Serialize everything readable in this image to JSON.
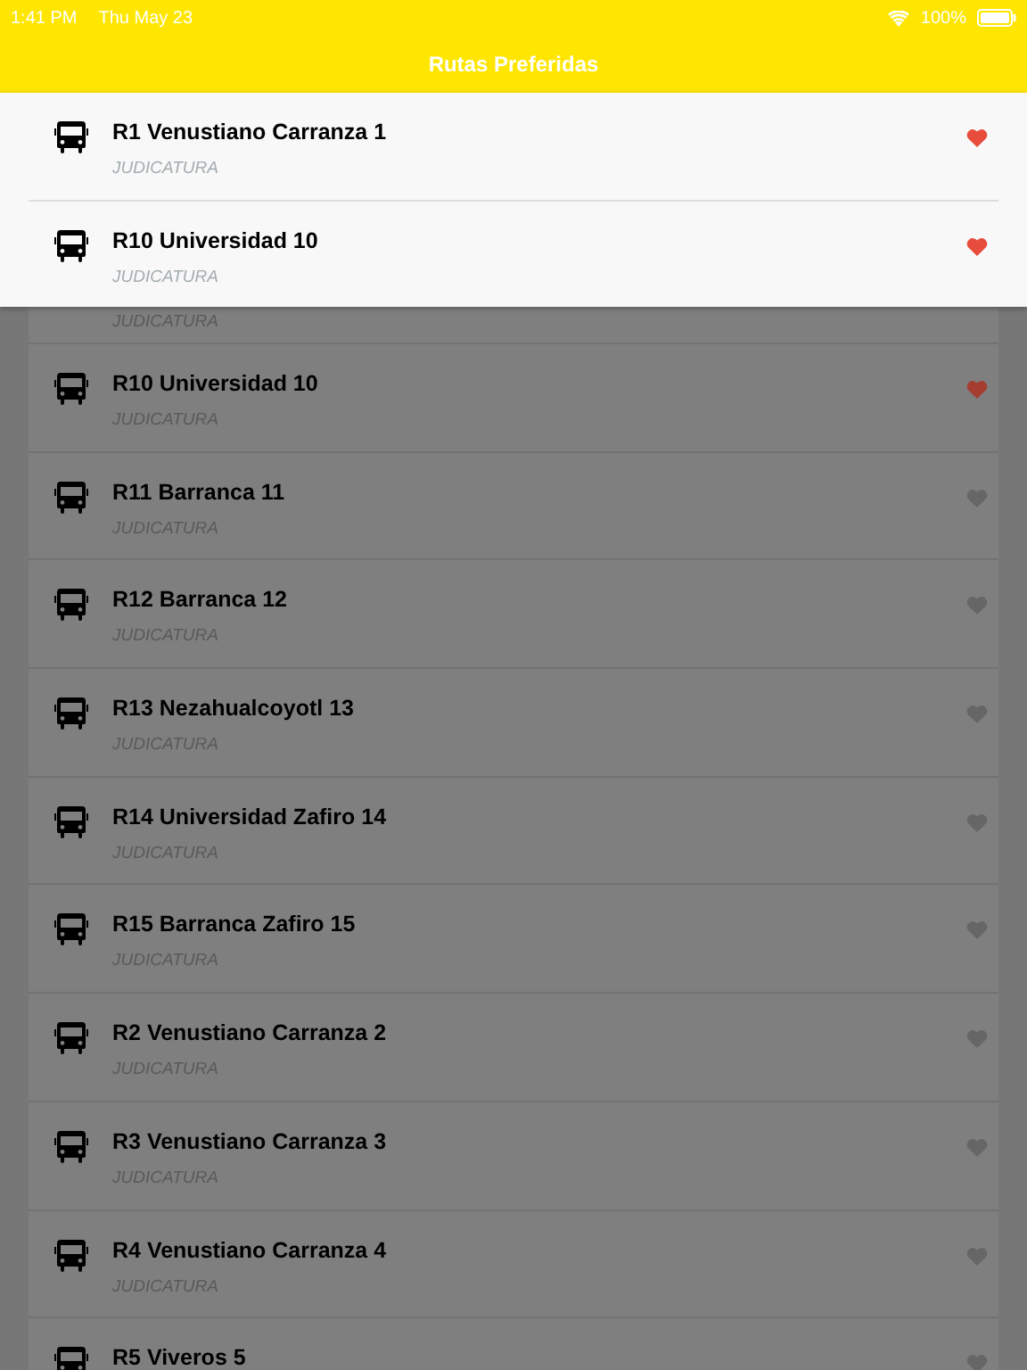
{
  "status_bar": {
    "time": "1:41 PM",
    "date": "Thu May 23",
    "battery": "100%"
  },
  "header": {
    "title": "Rutas Preferidas"
  },
  "favorites": [
    {
      "title": "R1 Venustiano Carranza 1",
      "subtitle": "JUDICATURA",
      "favorite": true
    },
    {
      "title": "R10 Universidad 10",
      "subtitle": "JUDICATURA",
      "favorite": true
    }
  ],
  "routes": [
    {
      "subtitle": "JUDICATURA"
    },
    {
      "title": "R10 Universidad 10",
      "subtitle": "JUDICATURA",
      "favorite": true
    },
    {
      "title": "R11 Barranca 11",
      "subtitle": "JUDICATURA",
      "favorite": false
    },
    {
      "title": "R12 Barranca 12",
      "subtitle": "JUDICATURA",
      "favorite": false
    },
    {
      "title": "R13 Nezahualcoyotl 13",
      "subtitle": "JUDICATURA",
      "favorite": false
    },
    {
      "title": "R14 Universidad Zafiro 14",
      "subtitle": "JUDICATURA",
      "favorite": false
    },
    {
      "title": "R15 Barranca Zafiro 15",
      "subtitle": "JUDICATURA",
      "favorite": false
    },
    {
      "title": "R2 Venustiano Carranza 2",
      "subtitle": "JUDICATURA",
      "favorite": false
    },
    {
      "title": "R3 Venustiano Carranza 3",
      "subtitle": "JUDICATURA",
      "favorite": false
    },
    {
      "title": "R4 Venustiano Carranza 4",
      "subtitle": "JUDICATURA",
      "favorite": false
    },
    {
      "title": "R5 Viveros 5",
      "favorite": false
    }
  ]
}
